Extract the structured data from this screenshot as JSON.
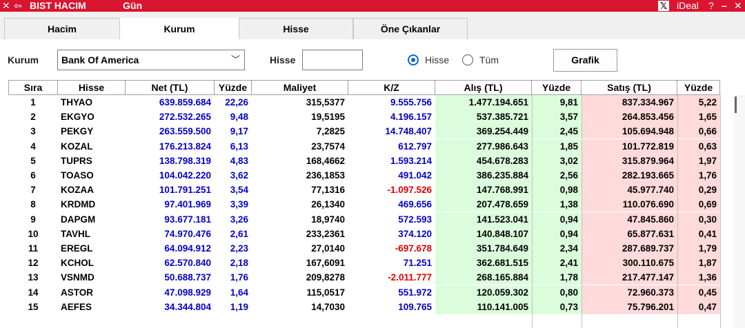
{
  "titlebar": {
    "close_icon": "✕",
    "back_icon": "⇦",
    "title": "BIST HACIM",
    "subtitle": "Gün",
    "x_logo": "𝕏",
    "brand": "iDeal",
    "help": "?",
    "minimize": "–",
    "close": "✕"
  },
  "tabs": [
    {
      "label": "Hacim"
    },
    {
      "label": "Kurum"
    },
    {
      "label": "Hisse"
    },
    {
      "label": "Öne Çıkanlar"
    }
  ],
  "toolbar": {
    "kurum_label": "Kurum",
    "kurum_value": "Bank Of America",
    "chevron": "﹀",
    "hisse_label": "Hisse",
    "hisse_value": "",
    "radio_hisse": "Hisse",
    "radio_tum": "Tüm",
    "grafik": "Grafik"
  },
  "columns": [
    "Sıra",
    "Hisse",
    "Net (TL)",
    "Yüzde",
    "Maliyet",
    "K/Z",
    "Alış (TL)",
    "Yüzde",
    "Satış (TL)",
    "Yüzde"
  ],
  "rows": [
    {
      "sira": "1",
      "hisse": "THYAO",
      "net": "639.859.684",
      "yuzde": "22,26",
      "maliyet": "315,5377",
      "kz": "9.555.756",
      "alis": "1.477.194.651",
      "alis_yuzde": "9,81",
      "satis": "837.334.967",
      "satis_yuzde": "5,22"
    },
    {
      "sira": "2",
      "hisse": "EKGYO",
      "net": "272.532.265",
      "yuzde": "9,48",
      "maliyet": "19,5195",
      "kz": "4.196.157",
      "alis": "537.385.721",
      "alis_yuzde": "3,57",
      "satis": "264.853.456",
      "satis_yuzde": "1,65"
    },
    {
      "sira": "3",
      "hisse": "PEKGY",
      "net": "263.559.500",
      "yuzde": "9,17",
      "maliyet": "7,2825",
      "kz": "14.748.407",
      "alis": "369.254.449",
      "alis_yuzde": "2,45",
      "satis": "105.694.948",
      "satis_yuzde": "0,66"
    },
    {
      "sira": "4",
      "hisse": "KOZAL",
      "net": "176.213.824",
      "yuzde": "6,13",
      "maliyet": "23,7574",
      "kz": "612.797",
      "alis": "277.986.643",
      "alis_yuzde": "1,85",
      "satis": "101.772.819",
      "satis_yuzde": "0,63"
    },
    {
      "sira": "5",
      "hisse": "TUPRS",
      "net": "138.798.319",
      "yuzde": "4,83",
      "maliyet": "168,4662",
      "kz": "1.593.214",
      "alis": "454.678.283",
      "alis_yuzde": "3,02",
      "satis": "315.879.964",
      "satis_yuzde": "1,97"
    },
    {
      "sira": "6",
      "hisse": "TOASO",
      "net": "104.042.220",
      "yuzde": "3,62",
      "maliyet": "236,1853",
      "kz": "491.042",
      "alis": "386.235.884",
      "alis_yuzde": "2,56",
      "satis": "282.193.665",
      "satis_yuzde": "1,76"
    },
    {
      "sira": "7",
      "hisse": "KOZAA",
      "net": "101.791.251",
      "yuzde": "3,54",
      "maliyet": "77,1316",
      "kz": "-1.097.526",
      "alis": "147.768.991",
      "alis_yuzde": "0,98",
      "satis": "45.977.740",
      "satis_yuzde": "0,29"
    },
    {
      "sira": "8",
      "hisse": "KRDMD",
      "net": "97.401.969",
      "yuzde": "3,39",
      "maliyet": "26,1340",
      "kz": "469.656",
      "alis": "207.478.659",
      "alis_yuzde": "1,38",
      "satis": "110.076.690",
      "satis_yuzde": "0,69"
    },
    {
      "sira": "9",
      "hisse": "DAPGM",
      "net": "93.677.181",
      "yuzde": "3,26",
      "maliyet": "18,9740",
      "kz": "572.593",
      "alis": "141.523.041",
      "alis_yuzde": "0,94",
      "satis": "47.845.860",
      "satis_yuzde": "0,30"
    },
    {
      "sira": "10",
      "hisse": "TAVHL",
      "net": "74.970.476",
      "yuzde": "2,61",
      "maliyet": "233,2361",
      "kz": "374.120",
      "alis": "140.848.107",
      "alis_yuzde": "0,94",
      "satis": "65.877.631",
      "satis_yuzde": "0,41"
    },
    {
      "sira": "11",
      "hisse": "EREGL",
      "net": "64.094.912",
      "yuzde": "2,23",
      "maliyet": "27,0140",
      "kz": "-697.678",
      "alis": "351.784.649",
      "alis_yuzde": "2,34",
      "satis": "287.689.737",
      "satis_yuzde": "1,79"
    },
    {
      "sira": "12",
      "hisse": "KCHOL",
      "net": "62.570.840",
      "yuzde": "2,18",
      "maliyet": "167,6091",
      "kz": "71.251",
      "alis": "362.681.515",
      "alis_yuzde": "2,41",
      "satis": "300.110.675",
      "satis_yuzde": "1,87"
    },
    {
      "sira": "13",
      "hisse": "VSNMD",
      "net": "50.688.737",
      "yuzde": "1,76",
      "maliyet": "209,8278",
      "kz": "-2.011.777",
      "alis": "268.165.884",
      "alis_yuzde": "1,78",
      "satis": "217.477.147",
      "satis_yuzde": "1,36"
    },
    {
      "sira": "14",
      "hisse": "ASTOR",
      "net": "47.098.929",
      "yuzde": "1,64",
      "maliyet": "115,0517",
      "kz": "551.972",
      "alis": "120.059.302",
      "alis_yuzde": "0,80",
      "satis": "72.960.373",
      "satis_yuzde": "0,45"
    },
    {
      "sira": "15",
      "hisse": "AEFES",
      "net": "34.344.804",
      "yuzde": "1,19",
      "maliyet": "14,7030",
      "kz": "109.765",
      "alis": "110.141.005",
      "alis_yuzde": "0,73",
      "satis": "75.796.201",
      "satis_yuzde": "0,47"
    }
  ],
  "colors": {
    "titlebar": "#d9152f",
    "positive": "#0000c8",
    "negative": "#e00000",
    "buy_bg": "#dcfddc",
    "sell_bg": "#ffdada"
  }
}
